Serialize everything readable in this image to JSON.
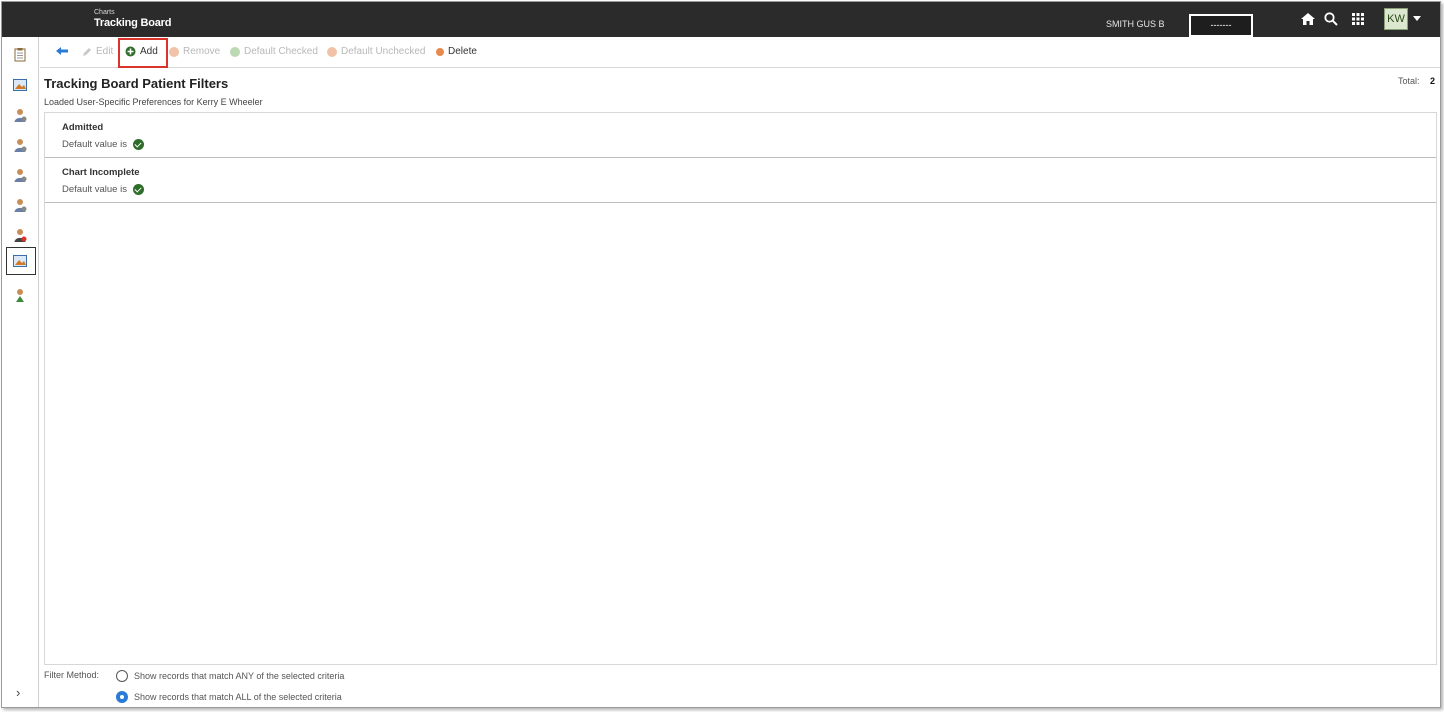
{
  "header": {
    "section": "Charts",
    "title": "Tracking Board",
    "patient_name": "SMITH GUS B",
    "patient_box_text": "-------",
    "user_initials": "KW"
  },
  "toolbar": {
    "back_icon": "back-arrow-icon",
    "edit_label": "Edit",
    "add_label": "Add",
    "remove_label": "Remove",
    "default_checked_label": "Default Checked",
    "default_unchecked_label": "Default Unchecked",
    "delete_label": "Delete"
  },
  "page": {
    "title": "Tracking Board Patient Filters",
    "subtitle": "Loaded User-Specific Preferences for Kerry E Wheeler",
    "total_label": "Total:",
    "total_value": "2"
  },
  "filters": [
    {
      "name": "Admitted",
      "default_text": "Default value is"
    },
    {
      "name": "Chart Incomplete",
      "default_text": "Default value is"
    }
  ],
  "filter_method": {
    "label": "Filter Method:",
    "options": [
      {
        "label": "Show records that match ANY of the selected criteria",
        "selected": false
      },
      {
        "label": "Show records that match ALL of the selected criteria",
        "selected": true
      }
    ]
  },
  "colors": {
    "topbar": "#2b2b2b",
    "add_highlight": "#d9342b",
    "check": "#2f6d2a",
    "radio_selected": "#2a7bd6"
  }
}
